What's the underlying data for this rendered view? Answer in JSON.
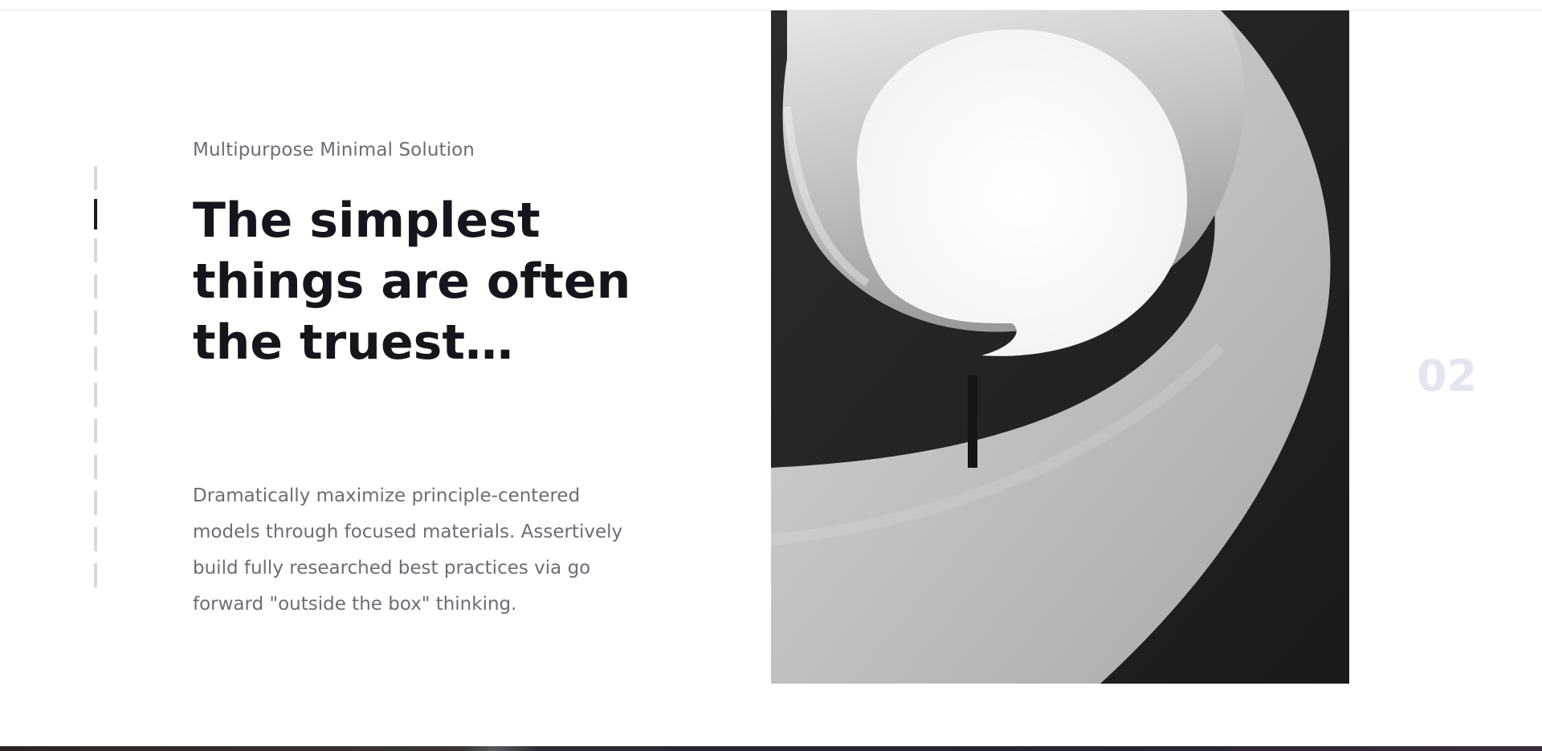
{
  "hero": {
    "eyebrow": "Multipurpose Minimal Solution",
    "headline": "The simplest things are often the truest…",
    "description": "Dramatically maximize principle-centered models through focused materials. Assertively build fully researched best practices via go forward \"outside the box\" thinking.",
    "slide_number": "02"
  },
  "slider": {
    "segments": 12,
    "active_segment": 1
  },
  "image": {
    "subject": "spiral staircase black and white photograph"
  },
  "colors": {
    "headline": "#15161c",
    "muted_text": "#6b6d76",
    "slide_number": "#e4e6ef",
    "progress_inactive": "#d8d8db",
    "progress_active": "#1b1c22"
  }
}
